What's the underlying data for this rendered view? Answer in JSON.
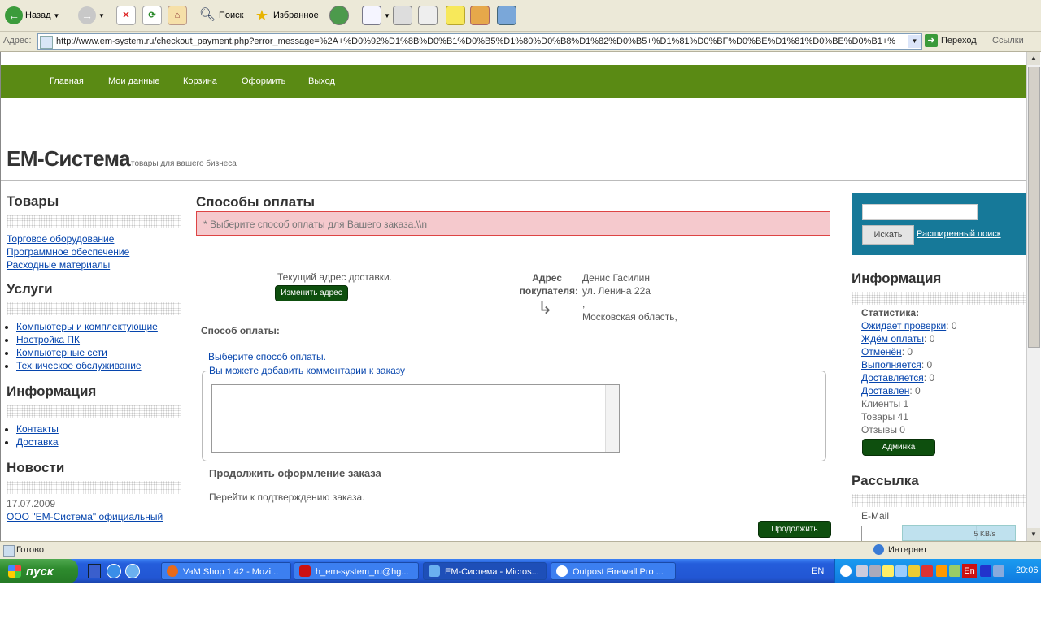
{
  "toolbar": {
    "back_label": "Назад",
    "search_label": "Поиск",
    "favorites_label": "Избранное"
  },
  "addressbar": {
    "label": "Адрес:",
    "url": "http://www.em-system.ru/checkout_payment.php?error_message=%2A+%D0%92%D1%8B%D0%B1%D0%B5%D1%80%D0%B8%D1%82%D0%B5+%D1%81%D0%BF%D0%BE%D1%81%D0%BE%D0%B1+%",
    "go_label": "Переход",
    "links_label": "Ссылки"
  },
  "nav": [
    "Главная",
    "Мои данные",
    "Корзина",
    "Оформить",
    "Выход"
  ],
  "site": {
    "brand": "EM-Система",
    "tagline": "товары для вашего бизнеса"
  },
  "left": {
    "goods_title": "Товары",
    "goods": [
      "Торговое оборудование",
      "Программное обеспечение",
      "Расходные материалы"
    ],
    "services_title": "Услуги",
    "services": [
      "Компьютеры и комплектующие",
      "Настройка ПК",
      "Компьютерные сети",
      "Техническое обслуживание"
    ],
    "info_title": "Информация",
    "info": [
      "Контакты",
      "Доставка"
    ],
    "news_title": "Новости",
    "news_date": "17.07.2009",
    "news_link": "ООО \"EM-Система\" официальный"
  },
  "main": {
    "title": "Способы оплаты",
    "error": "* Выберите способ оплаты для Вашего заказа.\\\\n",
    "current_address": "Текущий адрес доставки.",
    "change_address": "Изменить адрес",
    "buyer_address_label_1": "Адрес",
    "buyer_address_label_2": "покупателя:",
    "address_lines": [
      "Денис Гасилин",
      "ул. Ленина 22а",
      ",",
      "Московская область,"
    ],
    "payment_method": "Способ оплаты:",
    "choose_payment": "Выберите способ оплаты.",
    "comments_legend": "Вы можете добавить комментарии к заказу",
    "continue_title": "Продолжить оформление заказа",
    "go_confirm": "Перейти к подтверждению заказа.",
    "continue_button": "Продолжить"
  },
  "right": {
    "search_button": "Искать",
    "advanced_search": "Расширенный поиск",
    "info_title": "Информация",
    "stats_title": "Статистика:",
    "stats": [
      {
        "label": "Ожидает проверки",
        "value": ": 0"
      },
      {
        "label": "Ждём оплаты",
        "value": ": 0"
      },
      {
        "label": "Отменён",
        "value": ": 0"
      },
      {
        "label": "Выполняется",
        "value": ": 0"
      },
      {
        "label": "Доставляется",
        "value": ": 0"
      },
      {
        "label": "Доставлен",
        "value": ": 0"
      }
    ],
    "clients": "Клиенты 1",
    "goods": "Товары 41",
    "reviews": "Отзывы 0",
    "admin_button": "Админка",
    "newsletter_title": "Рассылка",
    "email_label": "E-Mail"
  },
  "status": {
    "ready": "Готово",
    "zone": "Интернет",
    "speed": "5 KB/s"
  },
  "taskbar": {
    "start": "пуск",
    "tasks": [
      "VaM Shop 1.42 - Mozi...",
      "h_em-system_ru@hg...",
      "EM-Система - Micros...",
      "Outpost Firewall Pro ..."
    ],
    "lang": "EN",
    "lang2": "En",
    "clock": "20:06"
  }
}
